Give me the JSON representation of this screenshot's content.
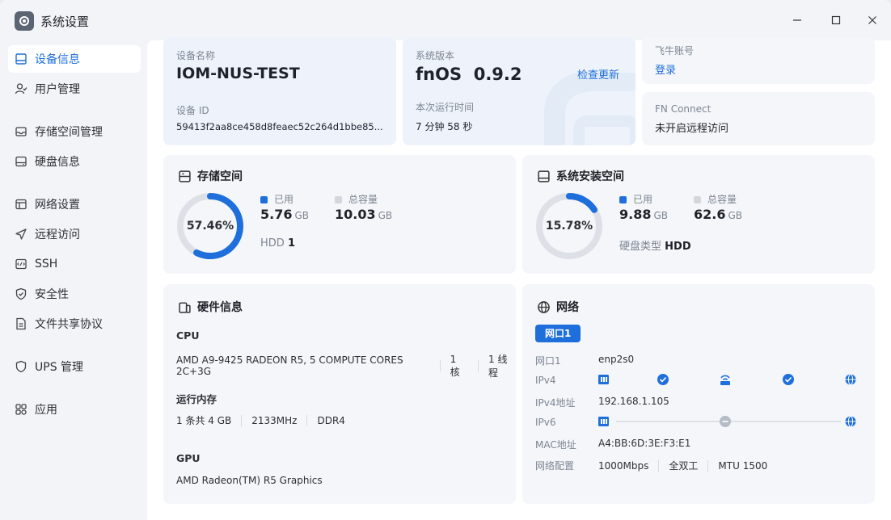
{
  "window": {
    "title": "系统设置"
  },
  "sidebar": {
    "items": [
      {
        "label": "设备信息",
        "icon": "device-icon",
        "active": true
      },
      {
        "label": "用户管理",
        "icon": "user-icon"
      },
      {
        "label": "存储空间管理",
        "icon": "storage-icon"
      },
      {
        "label": "硬盘信息",
        "icon": "disk-icon"
      },
      {
        "label": "网络设置",
        "icon": "network-icon"
      },
      {
        "label": "远程访问",
        "icon": "remote-icon"
      },
      {
        "label": "SSH",
        "icon": "ssh-icon"
      },
      {
        "label": "安全性",
        "icon": "shield-icon"
      },
      {
        "label": "文件共享协议",
        "icon": "file-share-icon"
      },
      {
        "label": "UPS 管理",
        "icon": "ups-icon"
      },
      {
        "label": "应用",
        "icon": "apps-icon"
      }
    ]
  },
  "device": {
    "name_label": "设备名称",
    "name": "IOM-NUS-TEST",
    "id_label": "设备 ID",
    "id": "59413f2aa8ce458d8feaec52c264d1bbe85..."
  },
  "system": {
    "version_label": "系统版本",
    "os": "fnOS",
    "version": "0.9.2",
    "check_update": "检查更新",
    "uptime_label": "本次运行时间",
    "uptime": "7 分钟 58 秒"
  },
  "account": {
    "label": "飞牛账号",
    "login": "登录",
    "fn_connect_label": "FN Connect",
    "fn_connect_status": "未开启远程访问"
  },
  "storage": {
    "title": "存储空间",
    "percent": "57.46%",
    "percent_value": 57.46,
    "used_label": "已用",
    "used": "5.76",
    "used_unit": "GB",
    "total_label": "总容量",
    "total": "10.03",
    "total_unit": "GB",
    "disk_type": "HDD",
    "disk_count": "1"
  },
  "sys_space": {
    "title": "系统安装空间",
    "percent": "15.78%",
    "percent_value": 15.78,
    "used_label": "已用",
    "used": "9.88",
    "used_unit": "GB",
    "total_label": "总容量",
    "total": "62.6",
    "total_unit": "GB",
    "disk_type_label": "硬盘类型",
    "disk_type": "HDD"
  },
  "hardware": {
    "title": "硬件信息",
    "cpu_label": "CPU",
    "cpu_model": "AMD A9-9425 RADEON R5, 5 COMPUTE CORES 2C+3G",
    "cpu_cores": "1 核",
    "cpu_threads": "1 线程",
    "mem_label": "运行内存",
    "mem_size": "1 条共 4 GB",
    "mem_speed": "2133MHz",
    "mem_type": "DDR4",
    "gpu_label": "GPU",
    "gpu_model": "AMD Radeon(TM) R5 Graphics"
  },
  "network": {
    "title": "网络",
    "tab": "网口1",
    "port_label": "网口1",
    "port": "enp2s0",
    "ipv4_label": "IPv4",
    "ipv4_addr_label": "IPv4地址",
    "ipv4_addr": "192.168.1.105",
    "ipv6_label": "IPv6",
    "mac_label": "MAC地址",
    "mac": "A4:BB:6D:3E:F3:E1",
    "config_label": "网络配置",
    "speed": "1000Mbps",
    "duplex": "全双工",
    "mtu": "MTU 1500"
  },
  "colors": {
    "accent": "#1e6fdc",
    "ring_track": "#dde1e7"
  }
}
